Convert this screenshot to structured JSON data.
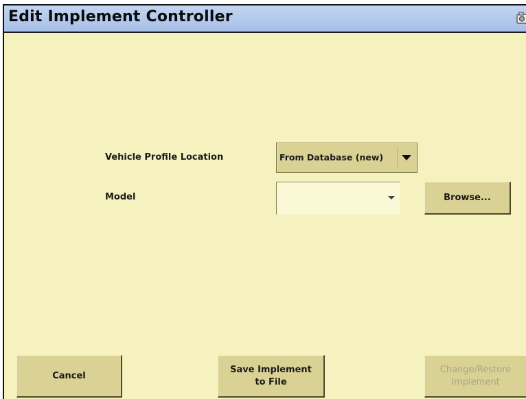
{
  "window": {
    "title": "Edit Implement Controller",
    "title_icon": "camera-icon"
  },
  "form": {
    "vehicle_profile_location_label": "Vehicle Profile Location",
    "vehicle_profile_location_value": "From Database (new)",
    "model_label": "Model",
    "model_value": "",
    "browse_label": "Browse..."
  },
  "footer": {
    "cancel_label": "Cancel",
    "save_label": "Save Implement\nto File",
    "change_label": "Change/Restore\nImplement",
    "change_enabled": false
  },
  "colors": {
    "titlebar": "#a7c0e8",
    "background": "#f6f2bf",
    "button": "#d9d294"
  }
}
